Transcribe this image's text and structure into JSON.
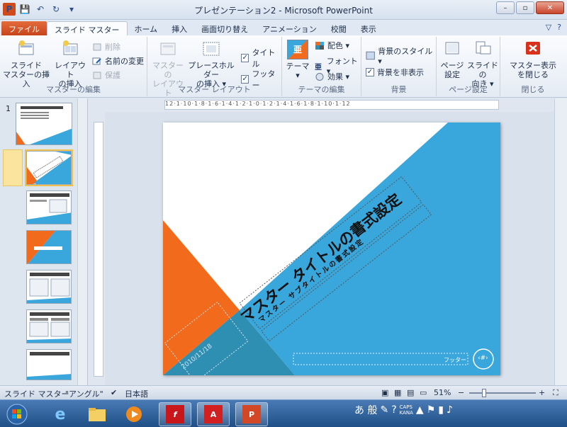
{
  "app": {
    "title": "プレゼンテーション2 - Microsoft PowerPoint",
    "logo": "P",
    "qat": {
      "save_icon": "💾",
      "undo_icon": "↶",
      "redo_icon": "↻",
      "customize_icon": "▾"
    },
    "window_buttons": {
      "minimize": "–",
      "restore": "▫",
      "close": "✕"
    }
  },
  "tabs": [
    {
      "label": "ファイル"
    },
    {
      "label": "スライド マスター"
    },
    {
      "label": "ホーム"
    },
    {
      "label": "挿入"
    },
    {
      "label": "画面切り替え"
    },
    {
      "label": "アニメーション"
    },
    {
      "label": "校閲"
    },
    {
      "label": "表示"
    }
  ],
  "tabs_right": {
    "minimize_ribbon": "▽",
    "help": "?"
  },
  "ribbon": {
    "groups": {
      "master_edit": "マスターの編集",
      "master_layout": "マスター レイアウト",
      "theme_edit": "テーマの編集",
      "background": "背景",
      "page_setup": "ページ設定",
      "close": "閉じる"
    },
    "insert_slide_master": [
      "スライド",
      "マスターの挿入"
    ],
    "insert_layout": [
      "レイアウト",
      "の挿入"
    ],
    "delete": "削除",
    "rename": "名前の変更",
    "preserve": "保護",
    "master_layout_btn": [
      "マスターの",
      "レイアウト"
    ],
    "insert_placeholder": [
      "プレースホルダー",
      "の挿入 ▾"
    ],
    "title_cb": "タイトル",
    "footer_cb": "フッター",
    "themes": [
      "テーマ",
      "▾"
    ],
    "colors": "配色 ▾",
    "fonts": "フォント ▾",
    "effects": "効果 ▾",
    "bg_styles": "背景のスタイル ▾",
    "hide_bg": "背景を非表示",
    "page_setup_btn": [
      "ページ",
      "設定"
    ],
    "slide_orientation": [
      "スライドの",
      "向き ▾"
    ],
    "close_master": [
      "マスター表示",
      "を閉じる"
    ],
    "check_mark": "✓",
    "theme_glyph": "亜",
    "font_glyph": "亜"
  },
  "slidepane": {
    "number": "1"
  },
  "ruler": {
    "horizontal": "12·1·10·1·8·1·6·1·4·1·2·1·0·1·2·1·4·1·6·1·8·1·10·1·12"
  },
  "slide": {
    "title": "マスター タイトルの書式設定",
    "subtitle": "マスター サブタイトルの書式設定",
    "date": "2010/11/18",
    "footer": "フッター",
    "page_number": "‹#›"
  },
  "statusbar": {
    "view": "スライド マスター",
    "theme": "\"アングル\"",
    "language": "日本語",
    "zoom": "51%",
    "zoom_out": "−",
    "zoom_in": "+"
  },
  "taskbar": {
    "ime": "あ 般",
    "caps": "CAPS",
    "kana": "KANA"
  },
  "colors": {
    "blue": "#3aa7dc",
    "orange": "#f26a1b",
    "teal": "#2e8fb3"
  }
}
